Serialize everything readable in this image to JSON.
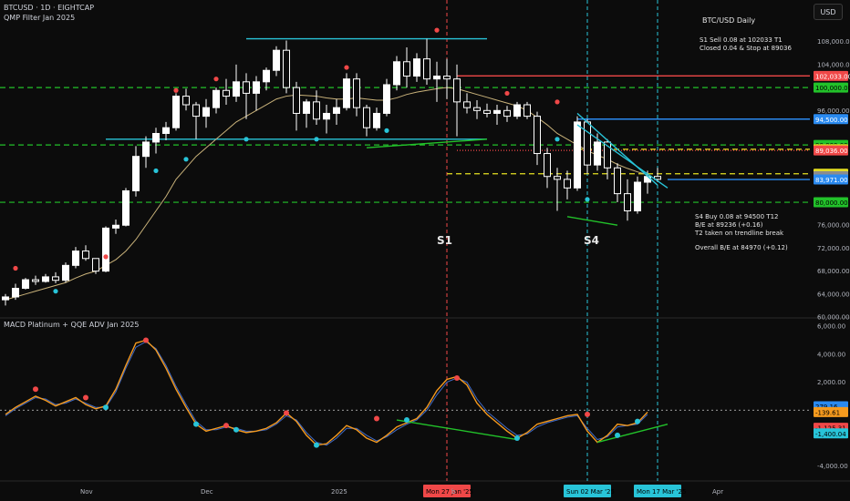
{
  "header": {
    "symbol_line": "BTCUSD · 1D · EIGHTCAP",
    "indicator_line": "QMP Filter Jan 2025",
    "lower_indicator": "MACD Platinum + QQE ADV Jan 2025",
    "currency_button": "USD"
  },
  "annotations": {
    "title": "BTC/USD Daily",
    "s1_note": [
      "S1 Sell 0.08 at 102033 T1",
      "Closed 0.04 & Stop at 89036"
    ],
    "s4_note": [
      "S4 Buy 0.08 at 94500 T12",
      "B/E at 89236 (+0.16)",
      "T2 taken on trendline break"
    ],
    "be_note": "Overall B/E at 84970 (+0.12)",
    "signals": [
      "S1",
      "S4"
    ]
  },
  "colors": {
    "background": "#0c0c0c",
    "candle": "#ffffff",
    "ma": "#c9b27a",
    "green_dash": "#22c22a",
    "cyan": "#28c4d8",
    "red": "#f04848",
    "yellow": "#e6e020",
    "blue": "#2a8af0",
    "macd_orange": "#f59a1e",
    "macd_blue": "#3f6bc8"
  },
  "chart_data": {
    "type": "candlestick",
    "title": "BTC/USD Daily",
    "price_axis": {
      "ticks": [
        {
          "value": 108000,
          "label": "108,000.00"
        },
        {
          "value": 104000,
          "label": "104,000.00"
        },
        {
          "value": 96000,
          "label": "96,000.00"
        },
        {
          "value": 76000,
          "label": "76,000.00"
        },
        {
          "value": 72000,
          "label": "72,000.00"
        },
        {
          "value": 68000,
          "label": "68,000.00"
        },
        {
          "value": 64000,
          "label": "64,000.00"
        },
        {
          "value": 60000,
          "label": "60,000.00"
        }
      ],
      "range": [
        60000,
        110500
      ]
    },
    "price_labels": [
      {
        "value": 102033,
        "label": "102,033.00",
        "color": "#f04848"
      },
      {
        "value": 100000,
        "label": "100,000.00",
        "color": "#22c22a"
      },
      {
        "value": 94500,
        "label": "94,500.00",
        "color": "#2a8af0"
      },
      {
        "value": 90000,
        "label": "90,000.00",
        "color": "#22c22a"
      },
      {
        "value": 89236,
        "label": "89,236.00",
        "color": "#e6e020"
      },
      {
        "value": 89036,
        "label": "89,036.00",
        "color": "#f04848"
      },
      {
        "value": 84970,
        "label": "84,970.00",
        "color": "#e6e020"
      },
      {
        "value": 84550,
        "label": "23:11:25",
        "color": "#8c8c8c"
      },
      {
        "value": 83971,
        "label": "83,971.00",
        "color": "#2a8af0"
      },
      {
        "value": 80000,
        "label": "80,000.00",
        "color": "#22c22a"
      }
    ],
    "hlines": [
      {
        "value": 100000,
        "style": "dashed",
        "color": "#22c22a",
        "from": "start"
      },
      {
        "value": 90000,
        "style": "dashed",
        "color": "#22c22a",
        "from": "start"
      },
      {
        "value": 80000,
        "style": "dashed",
        "color": "#22c22a",
        "from": "start"
      },
      {
        "value": 102033,
        "style": "solid",
        "color": "#f04848",
        "from_day": 45
      },
      {
        "value": 94500,
        "style": "solid",
        "color": "#2a8af0",
        "from_day": 57
      },
      {
        "value": 89236,
        "style": "dashed",
        "color": "#e6e020",
        "from_day": 57
      },
      {
        "value": 89036,
        "style": "dotted",
        "color": "#f04848",
        "from_day": 45
      },
      {
        "value": 84970,
        "style": "dashed",
        "color": "#e6e020",
        "from_day": 44
      },
      {
        "value": 83971,
        "style": "solid",
        "color": "#2a8af0",
        "from_day": 66
      },
      {
        "value": 108500,
        "style": "solid",
        "color": "#28c4d8",
        "from_day": 24,
        "to_day": 48
      },
      {
        "value": 91000,
        "style": "solid",
        "color": "#28c4d8",
        "from_day": 10,
        "to_day": 48
      }
    ],
    "x_axis": {
      "labels": [
        "Nov",
        "Dec",
        "2025",
        "Mon 27 Jan '25",
        "b",
        "Sun 02 Mar '25",
        "Mon 17 Mar '25",
        "Apr"
      ],
      "positions_day": [
        8,
        20,
        33,
        44,
        45,
        58,
        65,
        71
      ]
    },
    "candles": [
      {
        "o": 63000,
        "h": 64000,
        "l": 62000,
        "c": 63500
      },
      {
        "o": 63500,
        "h": 65800,
        "l": 63000,
        "c": 65000
      },
      {
        "o": 65000,
        "h": 66800,
        "l": 64800,
        "c": 66500
      },
      {
        "o": 66500,
        "h": 67200,
        "l": 65600,
        "c": 66200
      },
      {
        "o": 66200,
        "h": 67500,
        "l": 66000,
        "c": 67000
      },
      {
        "o": 67000,
        "h": 67800,
        "l": 65900,
        "c": 66400
      },
      {
        "o": 66400,
        "h": 69500,
        "l": 66000,
        "c": 69000
      },
      {
        "o": 69000,
        "h": 72200,
        "l": 68500,
        "c": 71500
      },
      {
        "o": 71500,
        "h": 72500,
        "l": 69800,
        "c": 70200
      },
      {
        "o": 70200,
        "h": 69800,
        "l": 67500,
        "c": 68000
      },
      {
        "o": 68000,
        "h": 75800,
        "l": 67800,
        "c": 75500
      },
      {
        "o": 75500,
        "h": 77000,
        "l": 74500,
        "c": 76000
      },
      {
        "o": 76000,
        "h": 82500,
        "l": 75800,
        "c": 82000
      },
      {
        "o": 82000,
        "h": 89800,
        "l": 81000,
        "c": 88000
      },
      {
        "o": 88000,
        "h": 91500,
        "l": 86000,
        "c": 90500
      },
      {
        "o": 90500,
        "h": 93000,
        "l": 88500,
        "c": 92000
      },
      {
        "o": 92000,
        "h": 94000,
        "l": 90800,
        "c": 93000
      },
      {
        "o": 93000,
        "h": 99000,
        "l": 92500,
        "c": 98500
      },
      {
        "o": 98500,
        "h": 99800,
        "l": 96000,
        "c": 97000
      },
      {
        "o": 97000,
        "h": 97500,
        "l": 91000,
        "c": 95000
      },
      {
        "o": 95000,
        "h": 98000,
        "l": 93000,
        "c": 96500
      },
      {
        "o": 96500,
        "h": 100000,
        "l": 95500,
        "c": 99500
      },
      {
        "o": 99500,
        "h": 101500,
        "l": 97000,
        "c": 98500
      },
      {
        "o": 98500,
        "h": 104000,
        "l": 97500,
        "c": 101000
      },
      {
        "o": 101000,
        "h": 102500,
        "l": 94500,
        "c": 99000
      },
      {
        "o": 99000,
        "h": 102000,
        "l": 96000,
        "c": 101000
      },
      {
        "o": 101000,
        "h": 103500,
        "l": 99500,
        "c": 103000
      },
      {
        "o": 103000,
        "h": 107200,
        "l": 102000,
        "c": 106500
      },
      {
        "o": 106500,
        "h": 108200,
        "l": 99000,
        "c": 100000
      },
      {
        "o": 100000,
        "h": 101000,
        "l": 92500,
        "c": 95500
      },
      {
        "o": 95500,
        "h": 98000,
        "l": 93000,
        "c": 97500
      },
      {
        "o": 97500,
        "h": 99500,
        "l": 93500,
        "c": 94500
      },
      {
        "o": 94500,
        "h": 97000,
        "l": 92000,
        "c": 95500
      },
      {
        "o": 95500,
        "h": 98000,
        "l": 93500,
        "c": 96500
      },
      {
        "o": 96500,
        "h": 102500,
        "l": 96000,
        "c": 101500
      },
      {
        "o": 101500,
        "h": 102500,
        "l": 95000,
        "c": 96500
      },
      {
        "o": 96500,
        "h": 97000,
        "l": 91500,
        "c": 93000
      },
      {
        "o": 93000,
        "h": 96500,
        "l": 92500,
        "c": 95500
      },
      {
        "o": 95500,
        "h": 101500,
        "l": 95000,
        "c": 100500
      },
      {
        "o": 100500,
        "h": 105500,
        "l": 99500,
        "c": 104500
      },
      {
        "o": 104500,
        "h": 107000,
        "l": 100000,
        "c": 102000
      },
      {
        "o": 102000,
        "h": 106000,
        "l": 101000,
        "c": 105000
      },
      {
        "o": 105000,
        "h": 108500,
        "l": 100500,
        "c": 101500
      },
      {
        "o": 101500,
        "h": 104500,
        "l": 97500,
        "c": 102000
      },
      {
        "o": 102000,
        "h": 105000,
        "l": 98000,
        "c": 101500
      },
      {
        "o": 101500,
        "h": 104000,
        "l": 91500,
        "c": 97500
      },
      {
        "o": 97500,
        "h": 99000,
        "l": 95500,
        "c": 96500
      },
      {
        "o": 96500,
        "h": 97800,
        "l": 94500,
        "c": 96000
      },
      {
        "o": 96000,
        "h": 97200,
        "l": 94800,
        "c": 95500
      },
      {
        "o": 95500,
        "h": 97000,
        "l": 93500,
        "c": 96000
      },
      {
        "o": 96000,
        "h": 96800,
        "l": 94000,
        "c": 95000
      },
      {
        "o": 95000,
        "h": 97500,
        "l": 94500,
        "c": 97000
      },
      {
        "o": 97000,
        "h": 97500,
        "l": 94500,
        "c": 95000
      },
      {
        "o": 95000,
        "h": 95800,
        "l": 86500,
        "c": 88500
      },
      {
        "o": 88500,
        "h": 89500,
        "l": 82500,
        "c": 84500
      },
      {
        "o": 84500,
        "h": 86000,
        "l": 78500,
        "c": 84000
      },
      {
        "o": 84000,
        "h": 85500,
        "l": 80500,
        "c": 82500
      },
      {
        "o": 82500,
        "h": 95000,
        "l": 82000,
        "c": 94000
      },
      {
        "o": 94000,
        "h": 94500,
        "l": 85000,
        "c": 86500
      },
      {
        "o": 86500,
        "h": 92000,
        "l": 85500,
        "c": 90500
      },
      {
        "o": 90500,
        "h": 91000,
        "l": 84000,
        "c": 86000
      },
      {
        "o": 86000,
        "h": 86800,
        "l": 80000,
        "c": 81500
      },
      {
        "o": 81500,
        "h": 84000,
        "l": 76800,
        "c": 78500
      },
      {
        "o": 78500,
        "h": 84500,
        "l": 78000,
        "c": 83500
      },
      {
        "o": 83500,
        "h": 85500,
        "l": 81500,
        "c": 84500
      },
      {
        "o": 84500,
        "h": 86000,
        "l": 83500,
        "c": 84000
      }
    ],
    "ma": [
      63000,
      63500,
      64000,
      64500,
      65000,
      65500,
      66000,
      66800,
      67500,
      68000,
      69000,
      70000,
      71500,
      73500,
      76000,
      78500,
      81000,
      84000,
      86000,
      88000,
      89500,
      91000,
      92500,
      94000,
      95000,
      96000,
      97000,
      98000,
      98500,
      98700,
      98600,
      98500,
      98200,
      98000,
      98000,
      98200,
      98000,
      97800,
      97800,
      98200,
      98800,
      99200,
      99500,
      99800,
      100000,
      99800,
      99300,
      98800,
      98300,
      97800,
      97300,
      96800,
      96000,
      94800,
      93500,
      92000,
      91000,
      90000,
      89000,
      88200,
      87500,
      86600,
      85900,
      85300,
      84800
    ],
    "dots": [
      {
        "day": 1,
        "v": 68500,
        "color": "#f04848"
      },
      {
        "day": 5,
        "v": 64500,
        "color": "#28c4d8"
      },
      {
        "day": 10,
        "v": 70500,
        "color": "#f04848"
      },
      {
        "day": 17,
        "v": 99500,
        "color": "#f04848"
      },
      {
        "day": 21,
        "v": 101500,
        "color": "#f04848"
      },
      {
        "day": 15,
        "v": 85500,
        "color": "#28c4d8"
      },
      {
        "day": 18,
        "v": 87500,
        "color": "#28c4d8"
      },
      {
        "day": 24,
        "v": 91000,
        "color": "#28c4d8"
      },
      {
        "day": 34,
        "v": 103500,
        "color": "#f04848"
      },
      {
        "day": 38,
        "v": 92500,
        "color": "#28c4d8"
      },
      {
        "day": 43,
        "v": 110000,
        "color": "#f04848"
      },
      {
        "day": 31,
        "v": 91000,
        "color": "#28c4d8"
      },
      {
        "day": 50,
        "v": 99000,
        "color": "#f04848"
      },
      {
        "day": 55,
        "v": 97500,
        "color": "#f04848"
      },
      {
        "day": 55,
        "v": 91000,
        "color": "#28c4d8"
      },
      {
        "day": 58,
        "v": 80500,
        "color": "#28c4d8"
      }
    ],
    "trendlines": [
      {
        "points": [
          [
            36,
            89500
          ],
          [
            48,
            91000
          ]
        ],
        "color": "#22c22a"
      },
      {
        "points": [
          [
            56,
            77500
          ],
          [
            61,
            76000
          ]
        ],
        "color": "#22c22a"
      },
      {
        "points": [
          [
            57,
            95500
          ],
          [
            65,
            83000
          ]
        ],
        "color": "#28c4d8"
      },
      {
        "points": [
          [
            57,
            93500
          ],
          [
            66,
            82500
          ]
        ],
        "color": "#28c4d8"
      }
    ],
    "vlines": [
      {
        "day": 44,
        "color": "#f04848"
      },
      {
        "day": 58,
        "color": "#28c4d8"
      },
      {
        "day": 65,
        "color": "#28c4d8"
      }
    ],
    "macd": {
      "ticks": [
        {
          "value": 6000,
          "label": "6,000.00"
        },
        {
          "value": 4000,
          "label": "4,000.00"
        },
        {
          "value": 2000,
          "label": "2,000.00"
        },
        {
          "value": -4000,
          "label": "-4,000.00"
        }
      ],
      "range": [
        -4800,
        6400
      ],
      "zero_line": 0,
      "orange": [
        -300,
        200,
        600,
        1000,
        700,
        300,
        600,
        900,
        400,
        100,
        300,
        1500,
        3200,
        4800,
        5000,
        4300,
        3000,
        1500,
        200,
        -1000,
        -1500,
        -1300,
        -1100,
        -1400,
        -1600,
        -1500,
        -1300,
        -900,
        -200,
        -800,
        -1800,
        -2500,
        -2400,
        -1800,
        -1100,
        -1400,
        -2000,
        -2300,
        -1800,
        -1200,
        -900,
        -600,
        200,
        1400,
        2200,
        2400,
        1800,
        500,
        -300,
        -900,
        -1500,
        -2000,
        -1600,
        -1000,
        -800,
        -600,
        -400,
        -300,
        -1500,
        -2300,
        -1800,
        -1000,
        -1100,
        -900,
        -139.61
      ],
      "blue": [
        -400,
        100,
        500,
        900,
        800,
        400,
        500,
        800,
        500,
        200,
        200,
        1300,
        3000,
        4500,
        4900,
        4400,
        3200,
        1700,
        400,
        -800,
        -1400,
        -1400,
        -1200,
        -1300,
        -1500,
        -1500,
        -1400,
        -1000,
        -400,
        -700,
        -1600,
        -2300,
        -2500,
        -2000,
        -1300,
        -1300,
        -1800,
        -2200,
        -1900,
        -1400,
        -1000,
        -700,
        0,
        1100,
        2000,
        2300,
        2000,
        800,
        -100,
        -700,
        -1300,
        -1800,
        -1700,
        -1200,
        -900,
        -700,
        -500,
        -400,
        -1300,
        -2100,
        -1900,
        -1200,
        -1100,
        -1000,
        -300
      ],
      "dots": [
        {
          "day": 3,
          "v": 1500,
          "color": "#f04848"
        },
        {
          "day": 8,
          "v": 900,
          "color": "#f04848"
        },
        {
          "day": 10,
          "v": 200,
          "color": "#28c4d8"
        },
        {
          "day": 14,
          "v": 5000,
          "color": "#f04848"
        },
        {
          "day": 19,
          "v": -1000,
          "color": "#28c4d8"
        },
        {
          "day": 22,
          "v": -1100,
          "color": "#f04848"
        },
        {
          "day": 23,
          "v": -1400,
          "color": "#28c4d8"
        },
        {
          "day": 28,
          "v": -200,
          "color": "#f04848"
        },
        {
          "day": 31,
          "v": -2500,
          "color": "#28c4d8"
        },
        {
          "day": 37,
          "v": -600,
          "color": "#f04848"
        },
        {
          "day": 40,
          "v": -700,
          "color": "#28c4d8"
        },
        {
          "day": 45,
          "v": 2300,
          "color": "#f04848"
        },
        {
          "day": 51,
          "v": -2000,
          "color": "#28c4d8"
        },
        {
          "day": 58,
          "v": -300,
          "color": "#f04848"
        },
        {
          "day": 61,
          "v": -1800,
          "color": "#28c4d8"
        },
        {
          "day": 63,
          "v": -800,
          "color": "#28c4d8"
        }
      ],
      "trendlines": [
        {
          "points": [
            [
              39,
              -700
            ],
            [
              51,
              -2100
            ]
          ],
          "color": "#22c22a"
        },
        {
          "points": [
            [
              59,
              -2300
            ],
            [
              66,
              -1000
            ]
          ],
          "color": "#22c22a"
        }
      ],
      "labels": [
        {
          "value": 279.16,
          "label": "279.16",
          "color": "#2a8af0"
        },
        {
          "value": -139.61,
          "label": "-139.61",
          "color": "#f59a1e"
        },
        {
          "value": -1125.31,
          "label": "-1,125.31",
          "color": "#f04848"
        },
        {
          "value": -1400.04,
          "label": "-1,400.04",
          "color": "#28c4d8"
        }
      ]
    }
  }
}
